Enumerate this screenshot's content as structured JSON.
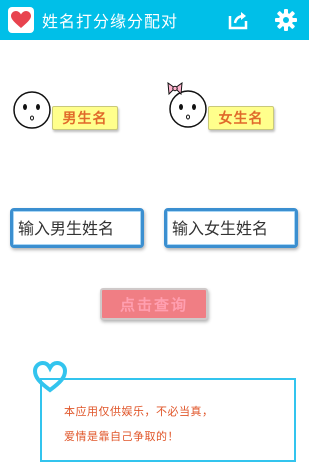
{
  "header": {
    "title": "姓名打分缘分配对",
    "icons": {
      "app": "heart-icon",
      "share": "share-icon",
      "settings": "gear-icon"
    },
    "background_color": "#00bfe8"
  },
  "male": {
    "label": "男生名",
    "input_placeholder": "输入男生姓名"
  },
  "female": {
    "label": "女生名",
    "input_placeholder": "输入女生姓名"
  },
  "query_button": {
    "label": "点击查询"
  },
  "note": {
    "line1": "本应用仅供娱乐，不必当真，",
    "line2": "爱情是靠自己争取的！"
  },
  "colors": {
    "accent": "#00bfe8",
    "label_bg": "#ffff8c",
    "label_text": "#e06a2a",
    "input_border": "#3b8fd0",
    "button_bg": "#f07e84",
    "note_text": "#e0562a"
  }
}
